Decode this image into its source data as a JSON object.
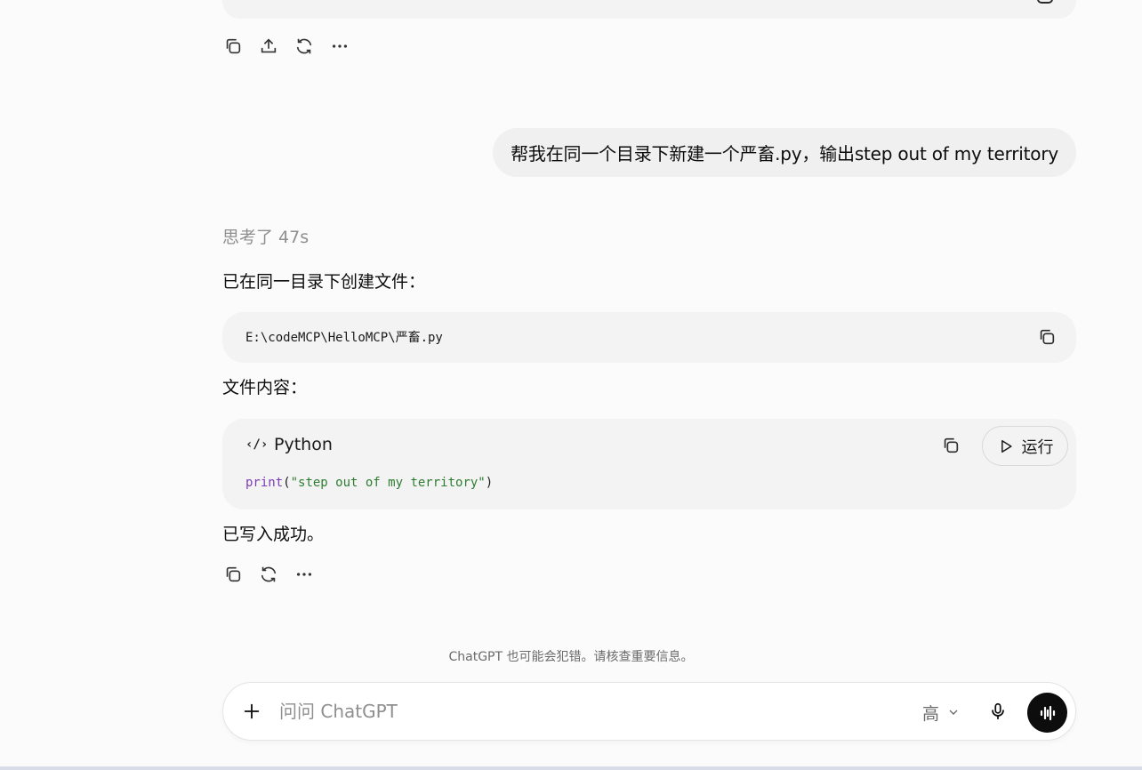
{
  "previous_message": {
    "actions": [
      "copy-icon",
      "share-icon",
      "regenerate-icon",
      "more-icon"
    ]
  },
  "user_message": {
    "text": "帮我在同一个目录下新建一个严畜.py，输出step out of my territory"
  },
  "assistant_message": {
    "thought_label": "思考了 47s",
    "intro": "已在同一目录下创建文件：",
    "file_path": "E:\\codeMCP\\HelloMCP\\严畜.py",
    "content_label": "文件内容：",
    "code_block": {
      "language": "Python",
      "run_label": "运行",
      "code_fn": "print",
      "code_open": "(",
      "code_str": "\"step out of my territory\"",
      "code_close": ")"
    },
    "result": "已写入成功。",
    "actions": [
      "copy-icon",
      "regenerate-icon",
      "more-icon"
    ]
  },
  "disclaimer": "ChatGPT 也可能会犯错。请核查重要信息。",
  "composer": {
    "placeholder": "问问 ChatGPT",
    "model_label": "高"
  }
}
